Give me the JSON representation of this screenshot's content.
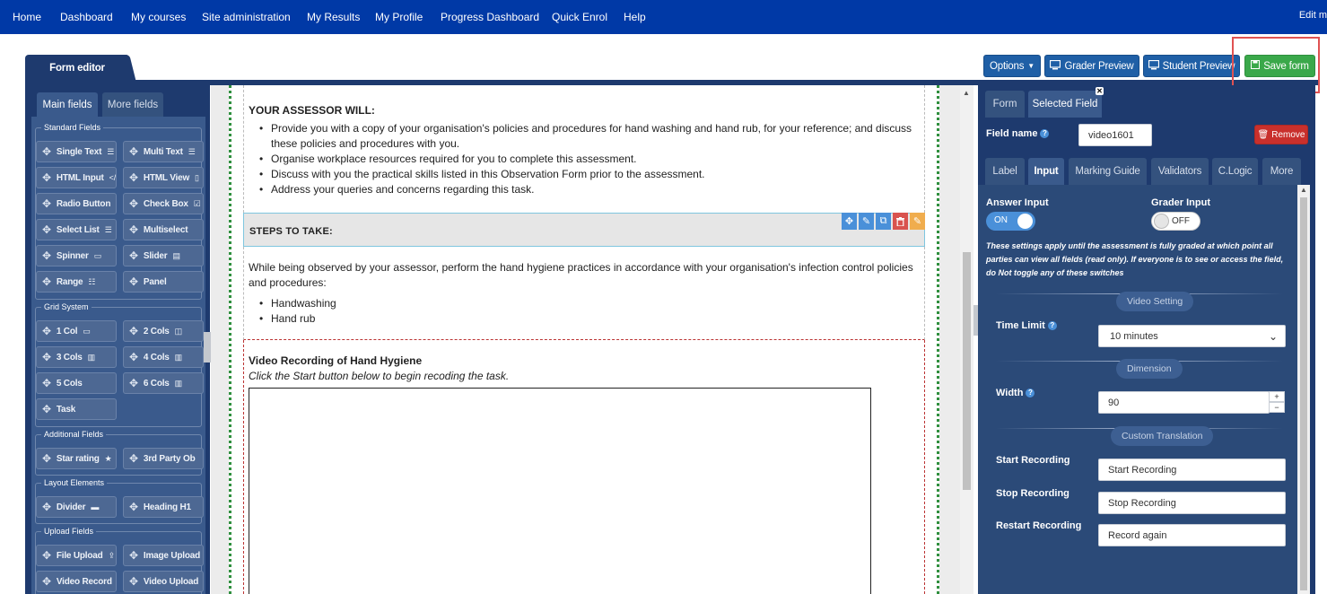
{
  "nav": {
    "items": [
      "Home",
      "Dashboard",
      "My courses",
      "Site administration",
      "My Results",
      "My Profile",
      "Progress Dashboard",
      "Quick Enrol",
      "Help"
    ],
    "edit_label": "Edit m"
  },
  "editor": {
    "tab_label": "Form editor",
    "buttons": {
      "options": "Options",
      "grader_preview": "Grader Preview",
      "student_preview": "Student Preview",
      "save_form": "Save form"
    }
  },
  "left_panel": {
    "tabs": [
      "Main fields",
      "More fields"
    ],
    "groups": [
      {
        "title": "Standard Fields",
        "items": [
          {
            "label": "Single Text",
            "icon": "list-icon"
          },
          {
            "label": "Multi Text",
            "icon": "list-icon"
          },
          {
            "label": "HTML Input",
            "icon": "code-icon"
          },
          {
            "label": "HTML View",
            "icon": "file-icon"
          },
          {
            "label": "Radio Button",
            "icon": ""
          },
          {
            "label": "Check Box",
            "icon": "checkbox-icon"
          },
          {
            "label": "Select List",
            "icon": "list-icon"
          },
          {
            "label": "Multiselect",
            "icon": ""
          },
          {
            "label": "Spinner",
            "icon": "spinner-icon"
          },
          {
            "label": "Slider",
            "icon": "slider-icon"
          },
          {
            "label": "Range",
            "icon": "range-icon"
          },
          {
            "label": "Panel",
            "icon": ""
          }
        ]
      },
      {
        "title": "Grid System",
        "items": [
          {
            "label": "1 Col",
            "icon": "cols-icon"
          },
          {
            "label": "2 Cols",
            "icon": "cols-icon"
          },
          {
            "label": "3 Cols",
            "icon": "cols-icon"
          },
          {
            "label": "4 Cols",
            "icon": "cols-icon"
          },
          {
            "label": "5 Cols",
            "icon": ""
          },
          {
            "label": "6 Cols",
            "icon": "cols-icon"
          },
          {
            "label": "Task",
            "icon": ""
          }
        ]
      },
      {
        "title": "Additional Fields",
        "items": [
          {
            "label": "Star rating",
            "icon": "star-icon"
          },
          {
            "label": "3rd Party Ob",
            "icon": ""
          }
        ]
      },
      {
        "title": "Layout Elements",
        "items": [
          {
            "label": "Divider",
            "icon": "dash-icon"
          },
          {
            "label": "Heading H1",
            "icon": ""
          }
        ]
      },
      {
        "title": "Upload Fields",
        "items": [
          {
            "label": "File Upload",
            "icon": "upload-icon"
          },
          {
            "label": "Image Upload",
            "icon": ""
          },
          {
            "label": "Video Record",
            "icon": ""
          },
          {
            "label": "Video Upload",
            "icon": ""
          }
        ]
      }
    ]
  },
  "canvas": {
    "assessor_heading": "YOUR ASSESSOR WILL:",
    "assessor_items": [
      "Provide you with a copy of your organisation's policies and procedures for hand washing and hand rub, for your reference; and discuss these policies and procedures with you.",
      "Organise workplace resources required for you to complete this assessment.",
      "Discuss with you the practical skills listed in this Observation Form prior to the assessment.",
      "Address your queries and concerns regarding this task."
    ],
    "steps_heading": "STEPS TO TAKE:",
    "steps_paragraph": "While being observed by your assessor, perform the hand hygiene practices in accordance with your organisation's infection control policies and procedures:",
    "steps_items": [
      "Handwashing",
      "Hand rub"
    ],
    "video_title": "Video Recording of Hand Hygiene",
    "video_subtitle": "Click the Start button below to begin recoding the task."
  },
  "right_panel": {
    "tabs": [
      "Form",
      "Selected Field"
    ],
    "field_name_label": "Field name",
    "field_name_value": "video1601",
    "remove_label": "Remove",
    "subtabs": [
      "Label",
      "Input",
      "Marking Guide",
      "Validators",
      "C.Logic",
      "More"
    ],
    "answer_input_label": "Answer Input",
    "answer_input_state": "ON",
    "grader_input_label": "Grader Input",
    "grader_input_state": "OFF",
    "note": "These settings apply until the assessment is fully graded at which point all parties can view all fields (read only). If everyone is to see or access the field, do Not toggle any of these switches",
    "video_setting_title": "Video Setting",
    "time_limit_label": "Time Limit",
    "time_limit_value": "10 minutes",
    "dimension_title": "Dimension",
    "width_label": "Width",
    "width_value": "90",
    "custom_translation_title": "Custom Translation",
    "start_recording_label": "Start Recording",
    "start_recording_value": "Start Recording",
    "stop_recording_label": "Stop Recording",
    "stop_recording_value": "Stop Recording",
    "restart_recording_label": "Restart Recording",
    "restart_recording_value": "Record again"
  },
  "colors": {
    "nav_bg": "#0039a6",
    "panel_bg": "#1e3a6e",
    "save_green": "#3aa84a",
    "remove_red": "#c9302c",
    "highlight_red": "#e05252"
  }
}
